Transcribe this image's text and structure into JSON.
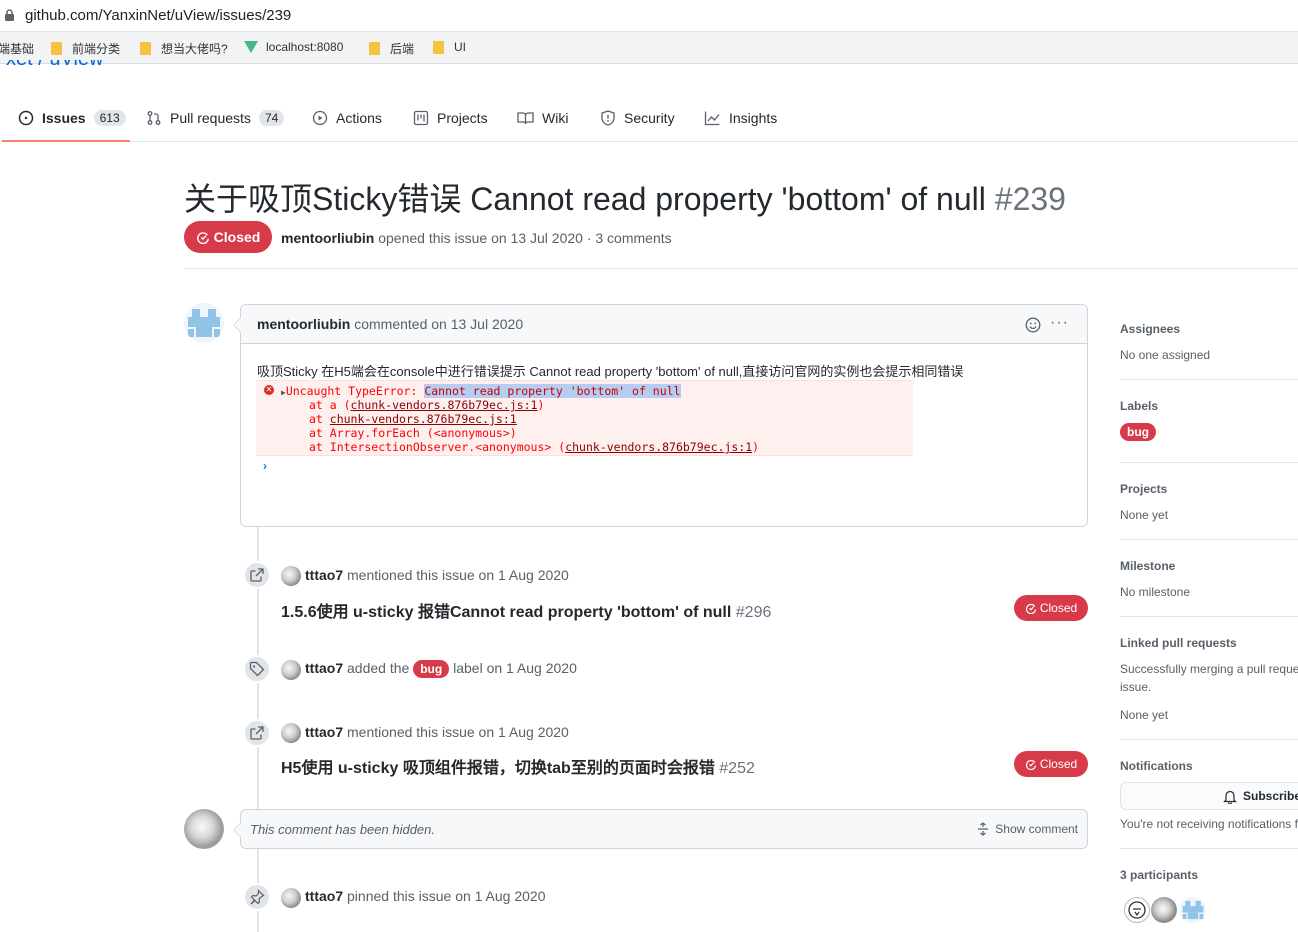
{
  "browser": {
    "url": "github.com/YanxinNet/uView/issues/239",
    "bookmarks": [
      "端基础",
      "前端分类",
      "想当大佬吗?",
      "localhost:8080",
      "后端",
      "UI"
    ]
  },
  "repo": {
    "peek": "xet / uView"
  },
  "nav": {
    "issues": "Issues",
    "issues_count": "613",
    "pulls": "Pull requests",
    "pulls_count": "74",
    "actions": "Actions",
    "projects": "Projects",
    "wiki": "Wiki",
    "security": "Security",
    "insights": "Insights"
  },
  "issue": {
    "title": "关于吸顶Sticky错误 Cannot read property 'bottom' of null",
    "number": "#239",
    "state": "Closed",
    "author": "mentoorliubin",
    "meta": "opened this issue on 13 Jul 2020 · 3 comments"
  },
  "comment": {
    "author": "mentoorliubin",
    "when": "commented on 13 Jul 2020",
    "text": "吸顶Sticky 在H5端会在console中进行错误提示 Cannot read property 'bottom' of null,直接访问官网的实例也会提示相同错误",
    "console": {
      "err_prefix": "Uncaught TypeError: ",
      "err_msg": "Cannot read property 'bottom' of null",
      "l2_pre": "at a (",
      "l2_link": "chunk-vendors.876b79ec.js:1",
      "l2_post": ")",
      "l3_pre": "at ",
      "l3_link": "chunk-vendors.876b79ec.js:1",
      "l4": "at Array.forEach (<anonymous>)",
      "l5_pre": "at IntersectionObserver.<anonymous> (",
      "l5_link": "chunk-vendors.876b79ec.js:1",
      "l5_post": ")"
    },
    "smile_icon": "smiley-icon",
    "more": "···"
  },
  "timeline": {
    "ev1": {
      "user": "tttao7",
      "text": "mentioned this issue on 1 Aug 2020",
      "ref_title": "1.5.6使用 u-sticky 报错Cannot read property 'bottom' of null",
      "ref_num": "#296",
      "state": "Closed"
    },
    "ev2": {
      "user": "tttao7",
      "pre": "added the",
      "label": "bug",
      "post": "label on 1 Aug 2020"
    },
    "ev3": {
      "user": "tttao7",
      "text": "mentioned this issue on 1 Aug 2020",
      "ref_title": "H5使用 u-sticky 吸顶组件报错，切换tab至别的页面时会报错",
      "ref_num": "#252",
      "state": "Closed"
    },
    "hidden": {
      "text": "This comment has been hidden.",
      "show": "Show comment"
    },
    "ev4": {
      "user": "tttao7",
      "text": "pinned this issue on 1 Aug 2020"
    }
  },
  "sidebar": {
    "assignees_title": "Assignees",
    "assignees_val": "No one assigned",
    "labels_title": "Labels",
    "label": "bug",
    "projects_title": "Projects",
    "projects_val": "None yet",
    "milestone_title": "Milestone",
    "milestone_val": "No milestone",
    "linked_title": "Linked pull requests",
    "linked_line1": "Successfully merging a pull reque",
    "linked_line2": "issue.",
    "linked_val": "None yet",
    "notifications_title": "Notifications",
    "subscribe": "Subscribe",
    "notif_note": "You're not receiving notifications f",
    "participants": "3 participants"
  },
  "colors": {
    "danger": "#d73a49",
    "link": "#0366d6",
    "tab_accent": "#f9826c"
  }
}
